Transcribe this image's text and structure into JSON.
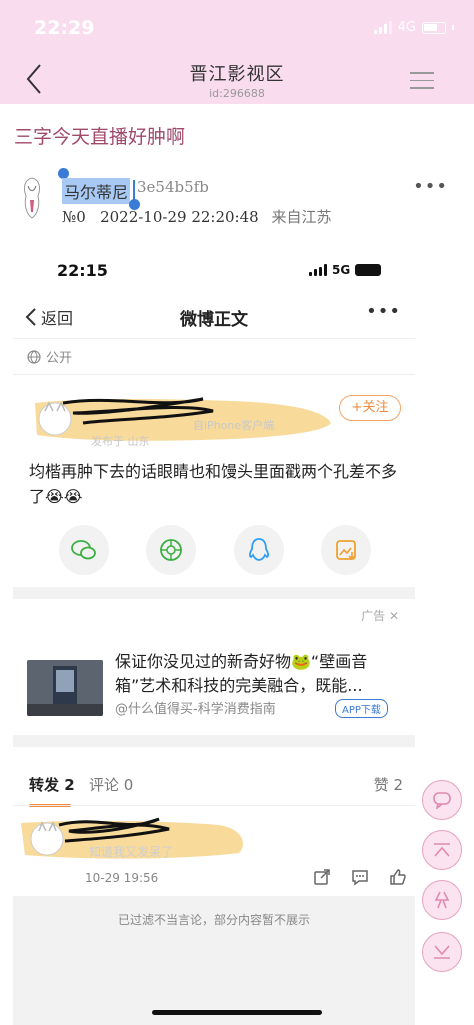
{
  "status_bar": {
    "time": "22:29",
    "network": "4G"
  },
  "nav": {
    "title": "晋江影视区",
    "subtitle": "id:296688"
  },
  "post": {
    "title": "三字今天直播好肿啊",
    "author_name": "马尔蒂尼",
    "author_hash": "3e54b5fb",
    "floor": "№0",
    "datetime": "2022-10-29 22:20:48",
    "location": "来自江苏"
  },
  "embedded": {
    "status_time": "22:15",
    "status_network": "5G",
    "back_label": "返回",
    "title": "微博正文",
    "visibility": "公开",
    "user_meta_1": "自iPhone客户端",
    "user_meta_2": "发布于 山东",
    "follow_label": "+关注",
    "body": "均楷再肿下去的话眼睛也和馒头里面戳两个孔差不多了😭😭",
    "ad": {
      "label": "广告",
      "text": "保证你没见过的新奇好物🐸“壁画音箱”艺术和科技的完美融合，既能...",
      "source": "@什么值得买-科学消费指南",
      "tag": "APP下载"
    },
    "tabs": {
      "repost": "转发 2",
      "comment": "评论 0",
      "likes": "赞 2"
    },
    "comment": {
      "meta": "知道我又发呆了",
      "time": "10-29 19:56"
    },
    "filter_notice": "已过滤不当言论，部分内容暂不展示"
  },
  "colors": {
    "nav_bg": "#f9dcee",
    "title_color": "#a04a6a",
    "accent": "#f08a3c",
    "fab_border": "#e8a0c0"
  }
}
